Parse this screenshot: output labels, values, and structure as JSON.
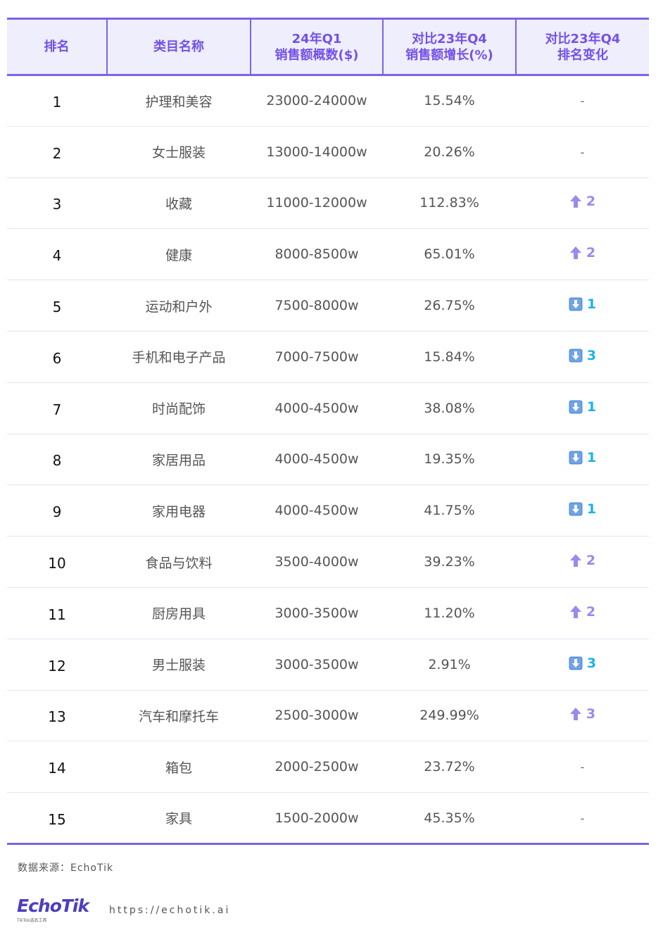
{
  "table": {
    "headers": [
      [
        "排名"
      ],
      [
        "类目名称"
      ],
      [
        "24年Q1",
        "销售额概数($)"
      ],
      [
        "对比23年Q4",
        "销售额增长(%)"
      ],
      [
        "对比23年Q4",
        "排名变化"
      ]
    ],
    "rows": [
      {
        "rank": "1",
        "category": "护理和美容",
        "sales": "23000-24000w",
        "growth": "15.54%",
        "change": {
          "dir": "none",
          "value": "-"
        }
      },
      {
        "rank": "2",
        "category": "女士服装",
        "sales": "13000-14000w",
        "growth": "20.26%",
        "change": {
          "dir": "none",
          "value": "-"
        }
      },
      {
        "rank": "3",
        "category": "收藏",
        "sales": "11000-12000w",
        "growth": "112.83%",
        "change": {
          "dir": "up",
          "value": "2"
        }
      },
      {
        "rank": "4",
        "category": "健康",
        "sales": "8000-8500w",
        "growth": "65.01%",
        "change": {
          "dir": "up",
          "value": "2"
        }
      },
      {
        "rank": "5",
        "category": "运动和户外",
        "sales": "7500-8000w",
        "growth": "26.75%",
        "change": {
          "dir": "down",
          "value": "1"
        }
      },
      {
        "rank": "6",
        "category": "手机和电子产品",
        "sales": "7000-7500w",
        "growth": "15.84%",
        "change": {
          "dir": "down",
          "value": "3"
        }
      },
      {
        "rank": "7",
        "category": "时尚配饰",
        "sales": "4000-4500w",
        "growth": "38.08%",
        "change": {
          "dir": "down",
          "value": "1"
        }
      },
      {
        "rank": "8",
        "category": "家居用品",
        "sales": "4000-4500w",
        "growth": "19.35%",
        "change": {
          "dir": "down",
          "value": "1"
        }
      },
      {
        "rank": "9",
        "category": "家用电器",
        "sales": "4000-4500w",
        "growth": "41.75%",
        "change": {
          "dir": "down",
          "value": "1"
        }
      },
      {
        "rank": "10",
        "category": "食品与饮料",
        "sales": "3500-4000w",
        "growth": "39.23%",
        "change": {
          "dir": "up",
          "value": "2"
        }
      },
      {
        "rank": "11",
        "category": "厨房用具",
        "sales": "3000-3500w",
        "growth": "11.20%",
        "change": {
          "dir": "up",
          "value": "2"
        }
      },
      {
        "rank": "12",
        "category": "男士服装",
        "sales": "3000-3500w",
        "growth": "2.91%",
        "change": {
          "dir": "down",
          "value": "3"
        }
      },
      {
        "rank": "13",
        "category": "汽车和摩托车",
        "sales": "2500-3000w",
        "growth": "249.99%",
        "change": {
          "dir": "up",
          "value": "3"
        }
      },
      {
        "rank": "14",
        "category": "箱包",
        "sales": "2000-2500w",
        "growth": "23.72%",
        "change": {
          "dir": "none",
          "value": "-"
        }
      },
      {
        "rank": "15",
        "category": "家具",
        "sales": "1500-2000w",
        "growth": "45.35%",
        "change": {
          "dir": "none",
          "value": "-"
        }
      }
    ]
  },
  "footer": {
    "source": "数据来源：EchoTik",
    "logo_text": "EchoTik",
    "logo_sub": "TikTok选品工具",
    "url": "https://echotik.ai"
  },
  "icons": {
    "up": "up-arrow-icon",
    "down": "down-arrow-box-icon"
  },
  "colors": {
    "accent": "#7e62e8",
    "header_bg": "#eeeefd",
    "header_text": "#7352e8",
    "up": "#9b89ec",
    "down": "#19b3e6",
    "logo": "#4b3fbf"
  }
}
